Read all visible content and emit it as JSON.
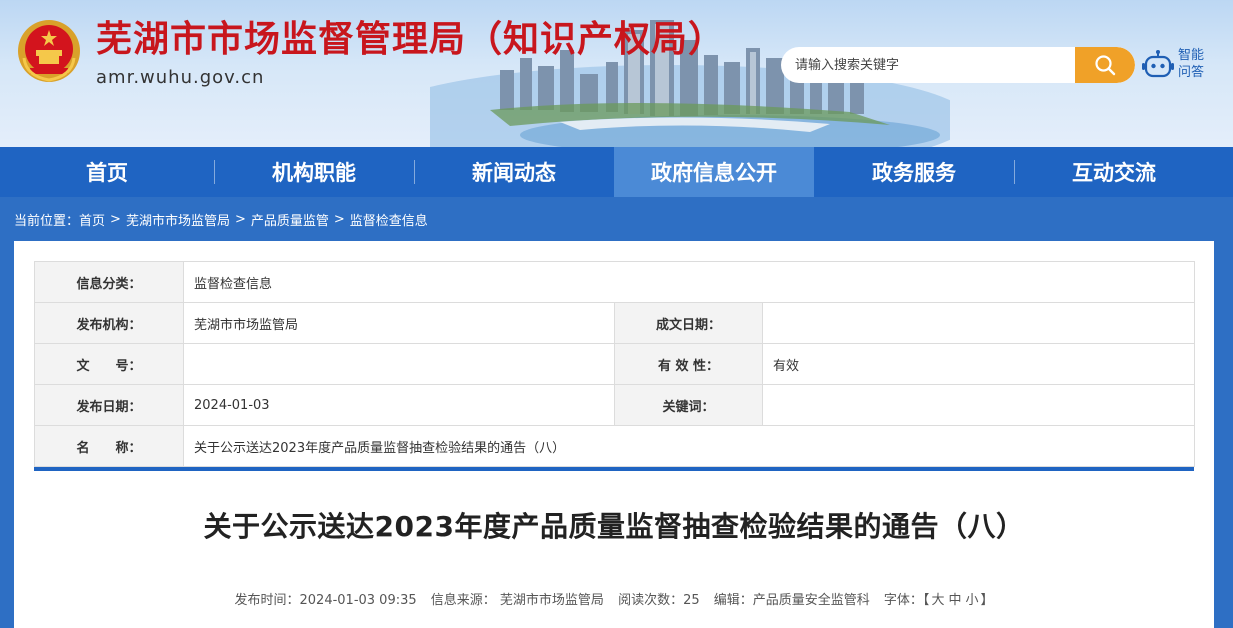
{
  "header": {
    "site_title": "芜湖市市场监督管理局（知识产权局）",
    "domain": "amr.wuhu.gov.cn",
    "search_placeholder": "请输入搜索关键字",
    "assistant_label": "智能问答"
  },
  "nav": {
    "items": [
      "首页",
      "机构职能",
      "新闻动态",
      "政府信息公开",
      "政务服务",
      "互动交流"
    ],
    "active_index": 3
  },
  "breadcrumb": {
    "prefix": "当前位置：",
    "items": [
      "首页",
      "芜湖市市场监管局",
      "产品质量监管",
      "监督检查信息"
    ],
    "separator": ">"
  },
  "info_table": {
    "category_label": "信息分类：",
    "category_value": "监督检查信息",
    "publisher_label": "发布机构：",
    "publisher_value": "芜湖市市场监管局",
    "created_label": "成文日期：",
    "created_value": "",
    "docno_label": "文　　号：",
    "docno_value": "",
    "validity_label": "有 效 性：",
    "validity_value": "有效",
    "pubdate_label": "发布日期：",
    "pubdate_value": "2024-01-03",
    "keywords_label": "关键词：",
    "keywords_value": "",
    "name_label": "名　　称：",
    "name_value": "关于公示送达2023年度产品质量监督抽查检验结果的通告（八）"
  },
  "article": {
    "title": "关于公示送达2023年度产品质量监督抽查检验结果的通告（八）",
    "publish_time": "发布时间：2024-01-03 09:35",
    "source": "信息来源： 芜湖市市场监管局",
    "views": "阅读次数：25",
    "editor": "编辑：产品质量安全监管科",
    "font_label": "字体：【",
    "font_large": "大",
    "font_medium": "中",
    "font_small": "小",
    "font_close": "】"
  },
  "colors": {
    "brand_red": "#c8161d",
    "nav_blue": "#1f64c2",
    "nav_active": "#4b8ad6",
    "search_orange": "#f0a128"
  }
}
